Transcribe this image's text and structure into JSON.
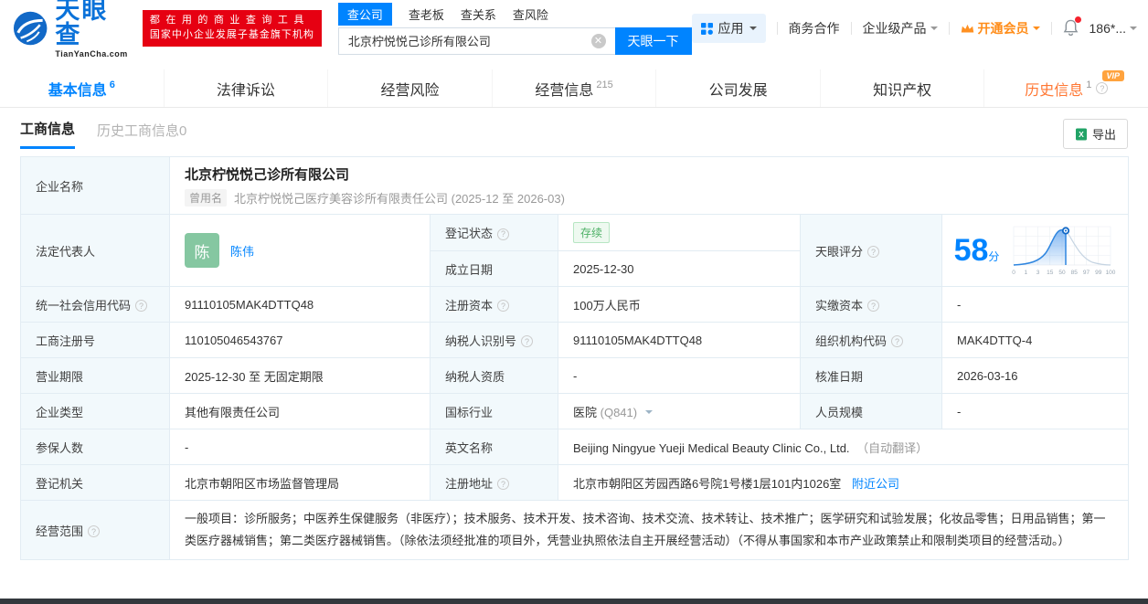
{
  "header": {
    "brand": "天眼查",
    "brand_domain": "TianYanCha.com",
    "slogan_line1": "都在用的商业查询工具",
    "slogan_line2": "国家中小企业发展子基金旗下机构",
    "search_tabs": {
      "company": "查公司",
      "boss": "查老板",
      "relation": "查关系",
      "risk": "查风险"
    },
    "search_value": "北京柠悦悦己诊所有限公司",
    "search_button": "天眼一下",
    "nav": {
      "apps": "应用",
      "cooperation": "商务合作",
      "enterprise": "企业级产品",
      "vip": "开通会员",
      "phone": "186*..."
    }
  },
  "tabs": {
    "basic": {
      "label": "基本信息",
      "count": "6"
    },
    "legal": {
      "label": "法律诉讼"
    },
    "risk": {
      "label": "经营风险"
    },
    "operation": {
      "label": "经营信息",
      "count": "215"
    },
    "development": {
      "label": "公司发展"
    },
    "ip": {
      "label": "知识产权"
    },
    "history": {
      "label": "历史信息",
      "count": "1",
      "vip": "VIP"
    }
  },
  "subtabs": {
    "current": "工商信息",
    "history": "历史工商信息",
    "history_count": "0",
    "export": "导出"
  },
  "info": {
    "company_name_label": "企业名称",
    "company_name": "北京柠悦悦己诊所有限公司",
    "former_badge": "曾用名",
    "former_name": "北京柠悦悦己医疗美容诊所有限责任公司 (2025-12 至 2026-03)",
    "legal_rep_label": "法定代表人",
    "legal_rep_avatar": "陈",
    "legal_rep": "陈伟",
    "reg_status_label": "登记状态",
    "reg_status": "存续",
    "est_date_label": "成立日期",
    "est_date": "2025-12-30",
    "score_label": "天眼评分",
    "score_value": "58",
    "score_unit": "分",
    "credit_code_label": "统一社会信用代码",
    "credit_code": "91110105MAK4DTTQ48",
    "reg_capital_label": "注册资本",
    "reg_capital": "100万人民币",
    "paid_capital_label": "实缴资本",
    "paid_capital": "-",
    "reg_number_label": "工商注册号",
    "reg_number": "110105046543767",
    "taxpayer_id_label": "纳税人识别号",
    "taxpayer_id": "91110105MAK4DTTQ48",
    "org_code_label": "组织机构代码",
    "org_code": "MAK4DTTQ-4",
    "business_term_label": "营业期限",
    "business_term": "2025-12-30 至 无固定期限",
    "taxpayer_quality_label": "纳税人资质",
    "taxpayer_quality": "-",
    "approval_date_label": "核准日期",
    "approval_date": "2026-03-16",
    "company_type_label": "企业类型",
    "company_type": "其他有限责任公司",
    "industry_label": "国标行业",
    "industry": "医院",
    "industry_code": "(Q841)",
    "staff_size_label": "人员规模",
    "staff_size": "-",
    "insured_label": "参保人数",
    "insured": "-",
    "english_name_label": "英文名称",
    "english_name": "Beijing Ningyue Yueji Medical Beauty Clinic Co., Ltd.",
    "english_name_note": "（自动翻译）",
    "reg_authority_label": "登记机关",
    "reg_authority": "北京市朝阳区市场监督管理局",
    "address_label": "注册地址",
    "address": "北京市朝阳区芳园西路6号院1号楼1层101内1026室",
    "nearby_link": "附近公司",
    "scope_label": "经营范围",
    "scope": "一般项目：诊所服务；中医养生保健服务（非医疗）；技术服务、技术开发、技术咨询、技术交流、技术转让、技术推广；医学研究和试验发展；化妆品零售；日用品销售；第一类医疗器械销售；第二类医疗器械销售。（除依法须经批准的项目外，凭营业执照依法自主开展经营活动）（不得从事国家和本市产业政策禁止和限制类项目的经营活动。）"
  },
  "chart_data": {
    "type": "area",
    "title": "天眼评分分布曲线",
    "score": 58,
    "x_tick_labels": [
      "0",
      "1",
      "3",
      "15",
      "50",
      "85",
      "97",
      "99",
      "100"
    ],
    "legend_position": "none",
    "grid": true
  },
  "colors": {
    "accent": "#0084ff",
    "logo_red": "#e60012",
    "history_orange": "#ff7733",
    "vip_orange": "#ff8d1a",
    "status_green": "#4db066",
    "avatar_green": "#85c7a1"
  }
}
